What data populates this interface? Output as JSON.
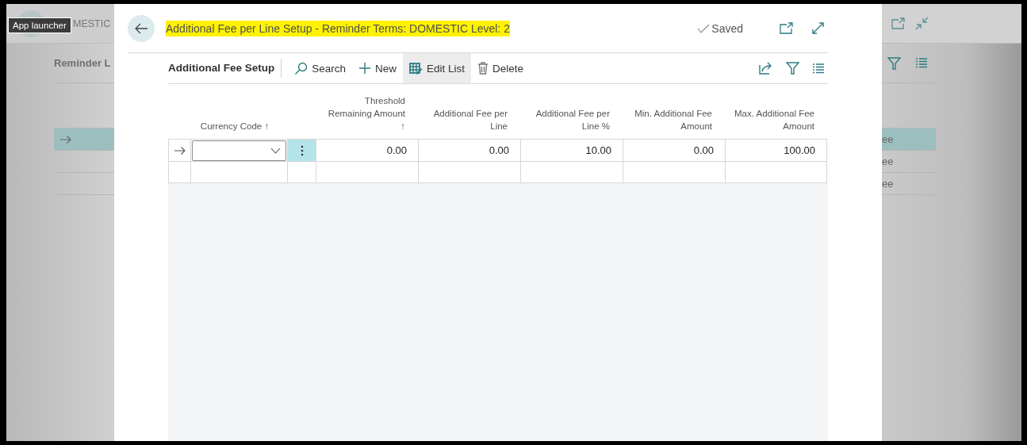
{
  "background_page": {
    "title_fragment": "MESTIC",
    "section_title_fragment": "Reminder L",
    "rows": [
      {
        "text": "ee",
        "selected": true
      },
      {
        "text": "ee",
        "selected": false
      },
      {
        "text": "ee",
        "selected": false
      }
    ]
  },
  "tooltip": {
    "text": "App launcher"
  },
  "dialog": {
    "title": "Additional Fee per Line Setup - Reminder Terms: DOMESTIC Level: 2",
    "title_highlighted": true,
    "status": "Saved",
    "toolbar": {
      "title": "Additional Fee Setup",
      "actions": [
        {
          "kind": "search",
          "label": "Search",
          "selected": false
        },
        {
          "kind": "new",
          "label": "New",
          "selected": false
        },
        {
          "kind": "edit",
          "label": "Edit List",
          "selected": true
        },
        {
          "kind": "delete",
          "label": "Delete",
          "selected": false
        }
      ]
    },
    "table": {
      "columns": [
        {
          "label": "Currency Code",
          "sort": "↑"
        },
        {
          "label": "Threshold Remaining Amount",
          "sort": "↑"
        },
        {
          "label": "Additional Fee per Line"
        },
        {
          "label": "Additional Fee per Line %"
        },
        {
          "label": "Min. Additional Fee Amount"
        },
        {
          "label": "Max. Additional Fee Amount"
        }
      ],
      "rows": [
        {
          "kind": "data",
          "current": true,
          "values": [
            "0.00",
            "0.00",
            "10.00",
            "0.00",
            "100.00"
          ]
        },
        {
          "kind": "new",
          "current": false
        }
      ]
    }
  }
}
